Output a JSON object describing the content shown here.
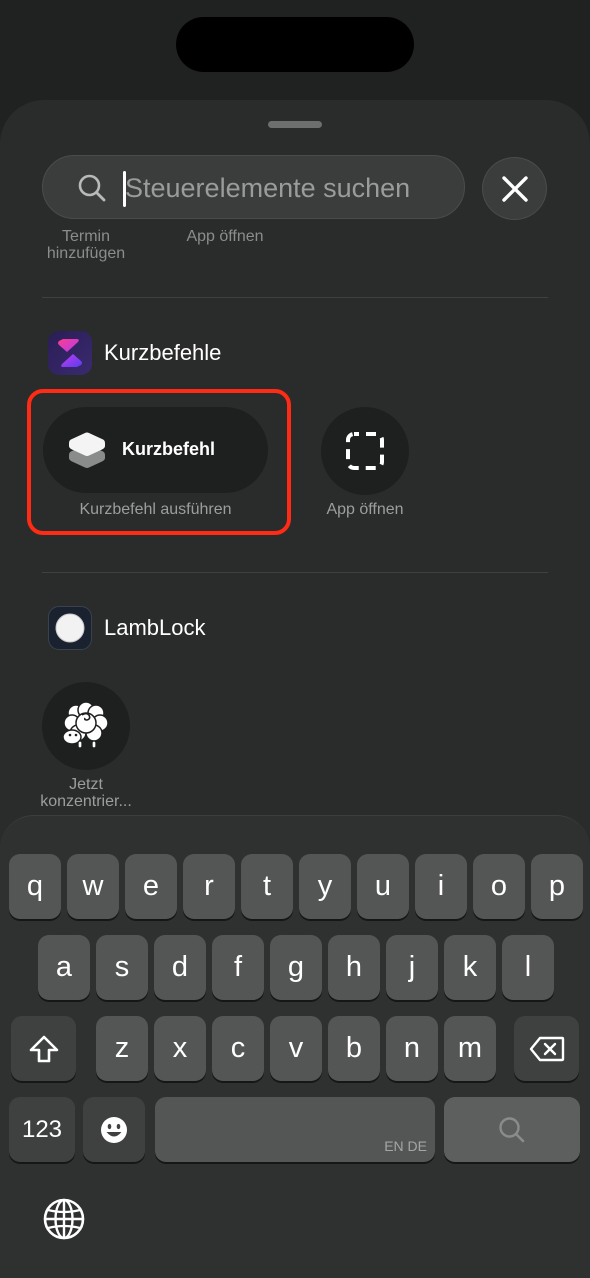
{
  "search": {
    "placeholder": "Steuerelemente suchen"
  },
  "background_labels": {
    "termin": "Termin\nhinzufügen",
    "app_offnen": "App öffnen"
  },
  "sections": [
    {
      "app_name": "Kurzbefehle",
      "controls": [
        {
          "label": "Kurzbefehl",
          "caption": "Kurzbefehl ausführen"
        },
        {
          "caption": "App öffnen"
        }
      ]
    },
    {
      "app_name": "LambLock",
      "controls": [
        {
          "caption": "Jetzt\nkonzentrier..."
        }
      ]
    }
  ],
  "keyboard": {
    "row1": [
      "q",
      "w",
      "e",
      "r",
      "t",
      "y",
      "u",
      "i",
      "o",
      "p"
    ],
    "row2": [
      "a",
      "s",
      "d",
      "f",
      "g",
      "h",
      "j",
      "k",
      "l"
    ],
    "row3": [
      "z",
      "x",
      "c",
      "v",
      "b",
      "n",
      "m"
    ],
    "numbers_key": "123",
    "space_language": "EN DE"
  },
  "colors": {
    "highlight": "#ff2b14",
    "shortcuts_gradient_start": "#ff3c8e",
    "shortcuts_gradient_end": "#5b3cf0"
  },
  "icons": [
    "search-icon",
    "close-icon",
    "shortcuts-app-icon",
    "layers-icon",
    "dashed-square-icon",
    "lamblock-app-icon",
    "sheep-icon",
    "shift-icon",
    "backspace-icon",
    "emoji-icon",
    "globe-icon"
  ]
}
